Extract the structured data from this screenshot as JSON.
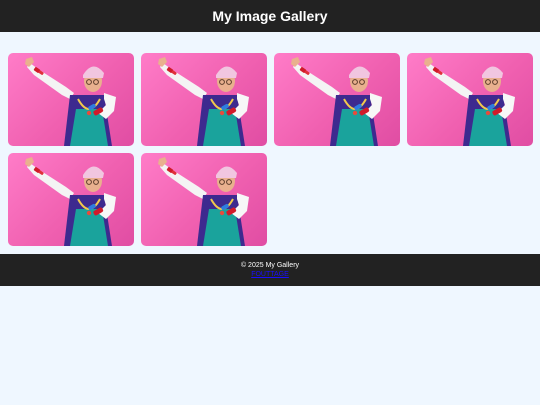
{
  "header": {
    "title": "My Image Gallery"
  },
  "gallery": {
    "images": [
      {
        "subject": "dabbing-woman"
      },
      {
        "subject": "dabbing-woman"
      },
      {
        "subject": "dabbing-woman"
      },
      {
        "subject": "dabbing-woman"
      },
      {
        "subject": "dabbing-woman"
      },
      {
        "subject": "dabbing-woman"
      }
    ]
  },
  "footer": {
    "copyright": "© 2025 My Gallery",
    "link_text": "FOUTTAGE"
  },
  "colors": {
    "bar": "#222222",
    "page_bg": "#eff7ff",
    "photo_bg": "#f060b0",
    "link": "#1a0dff"
  }
}
